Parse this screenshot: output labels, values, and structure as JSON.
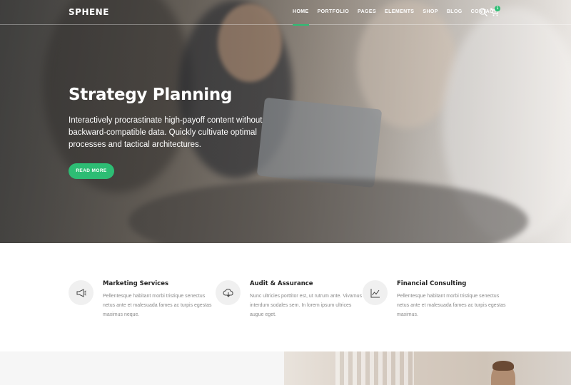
{
  "header": {
    "logo": "SPHENE",
    "nav": [
      "HOME",
      "PORTFOLIO",
      "PAGES",
      "ELEMENTS",
      "SHOP",
      "BLOG",
      "CONTACT"
    ],
    "active_nav": "HOME",
    "cart_count": "1",
    "icons": {
      "search": "search-icon",
      "cart": "cart-icon"
    }
  },
  "hero": {
    "title": "Strategy Planning",
    "text": "Interactively procrastinate high-payoff content without backward-compatible data. Quickly cultivate optimal processes and tactical architectures.",
    "button": "READ MORE"
  },
  "services": [
    {
      "icon": "megaphone-icon",
      "title": "Marketing Services",
      "text": "Pellentesque habitant morbi tristique senectus netus ante et malesuada fames ac turpis egestas maximus neque."
    },
    {
      "icon": "cloud-icon",
      "title": "Audit & Assurance",
      "text": "Nunc ultricies porttitor est, ut rutrum ante. Vivamus interdum sodales sem. In lorem ipsum ultrices augue eget."
    },
    {
      "icon": "line-chart-icon",
      "title": "Financial Consulting",
      "text": "Pellentesque habitant morbi tristique senectus netus ante et malesuada fames ac turpis egestas maximus."
    }
  ],
  "colors": {
    "accent": "#2dbd74",
    "text_dark": "#222222",
    "text_muted": "#8a8a8a"
  }
}
